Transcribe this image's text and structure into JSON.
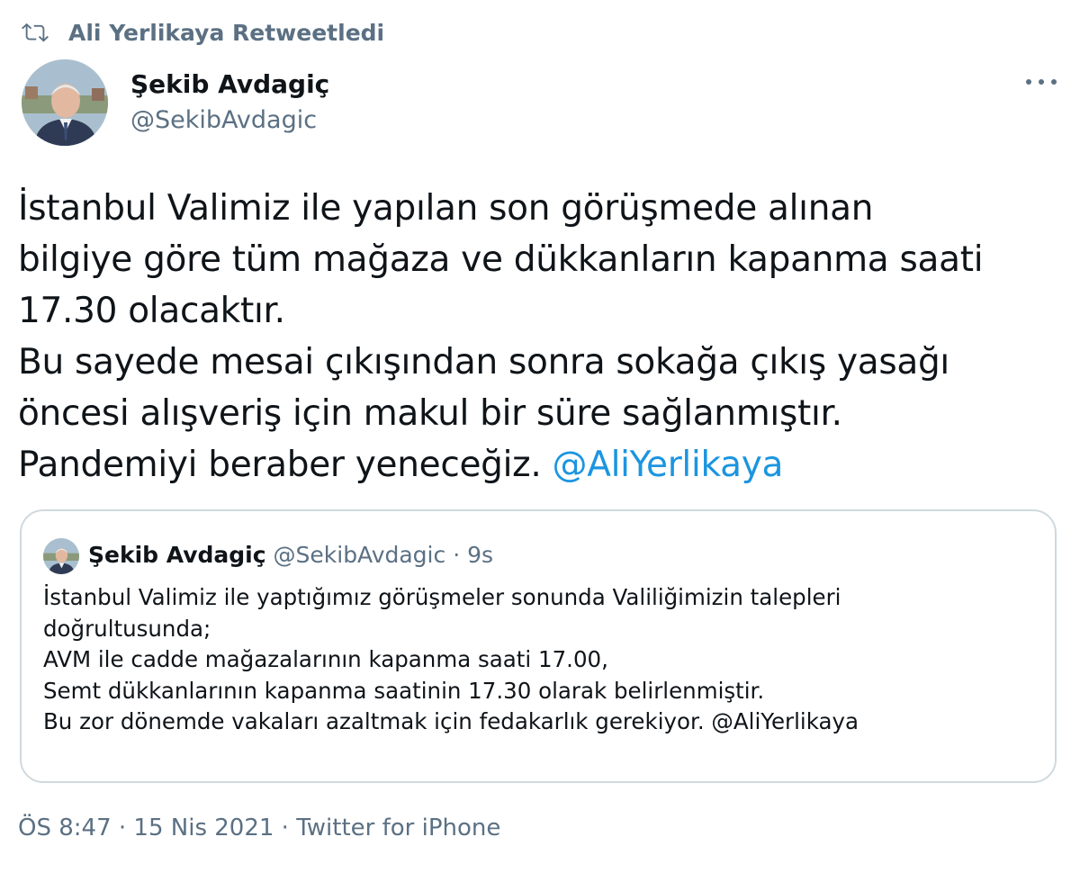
{
  "retweet": {
    "label": "Ali Yerlikaya Retweetledi",
    "icon": "retweet-icon"
  },
  "author": {
    "name": "Şekib Avdagiç",
    "handle": "@SekibAvdagic"
  },
  "more_icon": "more-options-icon",
  "tweet": {
    "text_line_1": "İstanbul Valimiz ile yapılan son görüşmede alınan\nbilgiye göre tüm mağaza ve dükkanların kapanma saati\n17.30 olacaktır.\nBu sayede mesai çıkışından sonra sokağa çıkış yasağı\nöncesi alışveriş için makul bir süre sağlanmıştır.\nPandemiyi beraber yeneceğiz. ",
    "mention": "@AliYerlikaya"
  },
  "quote": {
    "name": "Şekib Avdagiç",
    "handle": "@SekibAvdagic",
    "separator": " · ",
    "time": "9s",
    "text": "İstanbul Valimiz ile yaptığımız görüşmeler sonunda Valiliğimizin talepleri\ndoğrultusunda;\nAVM ile cadde mağazalarının kapanma saati 17.00,\nSemt dükkanlarının kapanma saatinin 17.30 olarak belirlenmiştir.\nBu zor dönemde vakaları azaltmak için fedakarlık gerekiyor. @AliYerlikaya"
  },
  "footer": {
    "time": "ÖS 8:47",
    "sep1": " · ",
    "date": "15 Nis 2021",
    "sep2": " · ",
    "source": "Twitter for iPhone"
  },
  "colors": {
    "text": "#0f1419",
    "secondary": "#5b7083",
    "link": "#1b95e0",
    "border": "#cfd9de"
  }
}
